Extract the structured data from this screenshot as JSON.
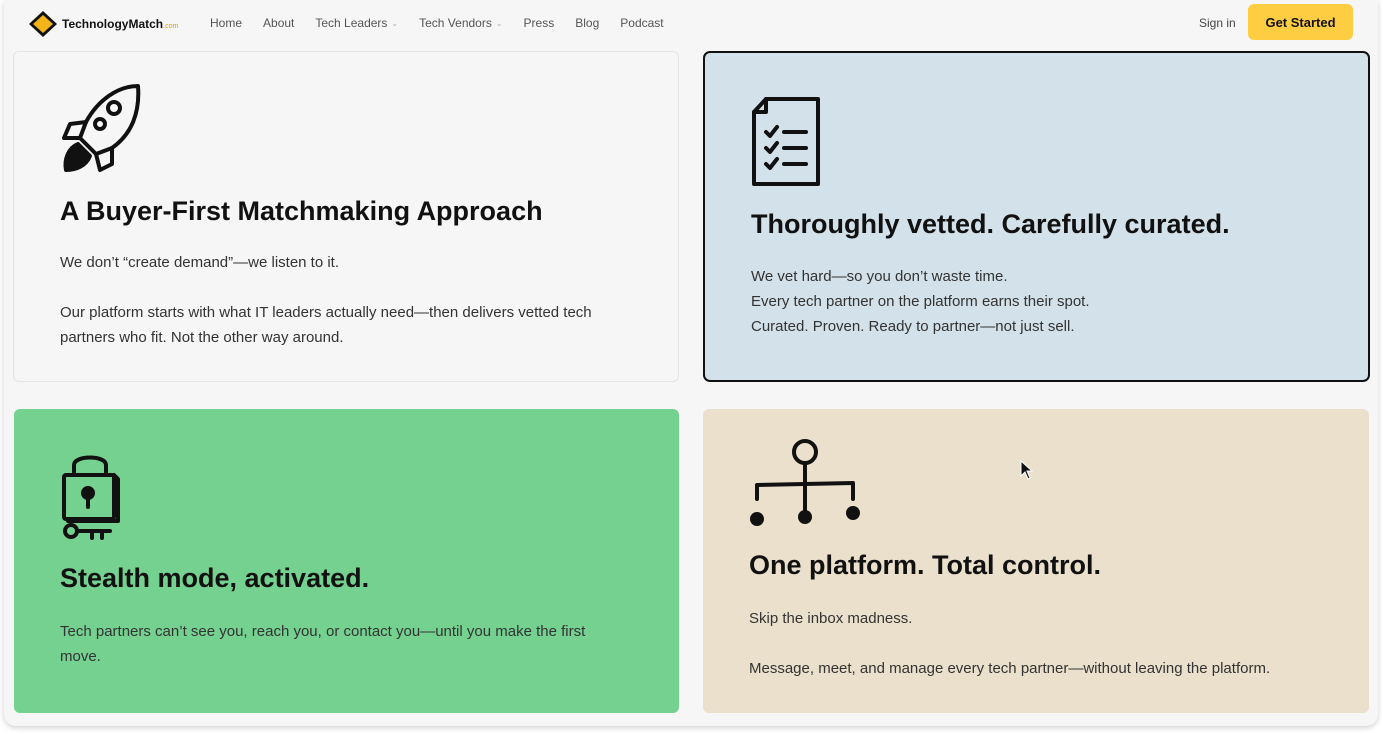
{
  "brand": {
    "name": "TechnologyMatch",
    "suffix": ".com",
    "accent": "#ffcd42"
  },
  "nav": {
    "items": [
      {
        "label": "Home",
        "dropdown": false
      },
      {
        "label": "About",
        "dropdown": false
      },
      {
        "label": "Tech Leaders",
        "dropdown": true
      },
      {
        "label": "Tech Vendors",
        "dropdown": true
      },
      {
        "label": "Press",
        "dropdown": false
      },
      {
        "label": "Blog",
        "dropdown": false
      },
      {
        "label": "Podcast",
        "dropdown": false
      }
    ],
    "signin": "Sign in",
    "cta": "Get Started"
  },
  "cards": [
    {
      "icon": "rocket-icon",
      "title": "A Buyer-First Matchmaking Approach",
      "paragraphs": [
        "We don’t “create demand”—we listen to it.",
        "Our platform starts with what IT leaders actually need—then delivers vetted tech partners who fit. Not the other way around."
      ],
      "bg": "#f6f6f6"
    },
    {
      "icon": "checklist-icon",
      "title": "Thoroughly vetted. Carefully curated.",
      "lines": [
        "We vet hard—so you don’t waste time.",
        "Every tech partner on the platform earns their spot.",
        "Curated. Proven. Ready to partner—not just sell."
      ],
      "bg": "#d3e1ea"
    },
    {
      "icon": "padlock-key-icon",
      "title": "Stealth mode, activated.",
      "paragraphs": [
        "Tech partners can’t see you, reach you, or contact you—until you make the first move."
      ],
      "bg": "#75d190"
    },
    {
      "icon": "hierarchy-icon",
      "title": "One platform. Total control.",
      "paragraphs": [
        "Skip the inbox madness.",
        "Message, meet, and manage every tech partner—without leaving the platform."
      ],
      "bg": "#eae0cc"
    }
  ]
}
